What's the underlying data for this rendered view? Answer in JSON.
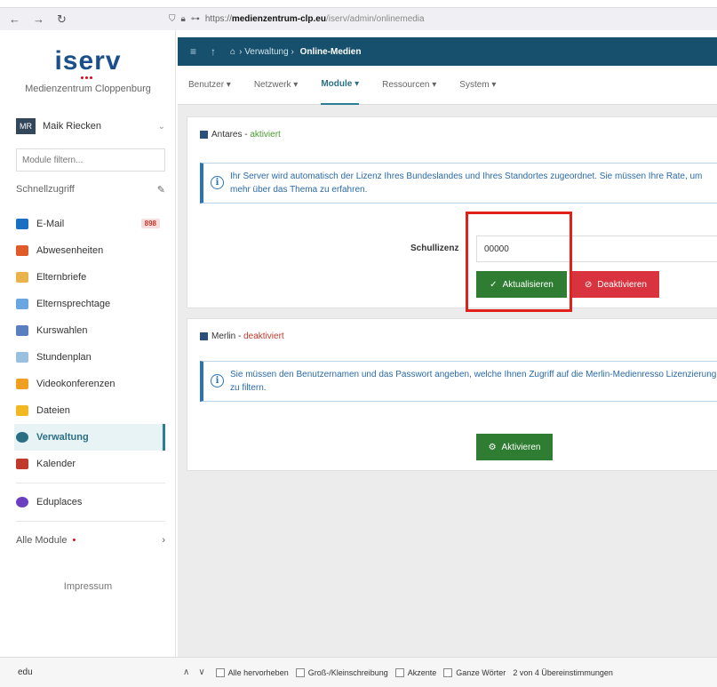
{
  "browser": {
    "back": "←",
    "forward": "→",
    "reload": "↻",
    "url_prefix": "https://",
    "url_domain": "medienzentrum-clp.eu",
    "url_path": "/iserv/admin/onlinemedia"
  },
  "sidebar": {
    "logo": "iserv",
    "school": "Medienzentrum Cloppenburg",
    "user_initials": "MR",
    "user_name": "Maik Riecken",
    "filter_placeholder": "Module filtern...",
    "quick_label": "Schnellzugriff",
    "items": [
      {
        "label": "E-Mail",
        "badge": "898",
        "icon": "mail-icon",
        "color": "#1b6fc2"
      },
      {
        "label": "Abwesenheiten",
        "icon": "absence-icon",
        "color": "#e05a2a"
      },
      {
        "label": "Elternbriefe",
        "icon": "letter-icon",
        "color": "#e8b44a"
      },
      {
        "label": "Elternsprechtage",
        "icon": "people-icon",
        "color": "#6aa6e0"
      },
      {
        "label": "Kurswahlen",
        "icon": "course-icon",
        "color": "#5a7fc0"
      },
      {
        "label": "Stundenplan",
        "icon": "timetable-icon",
        "color": "#9ac0e0"
      },
      {
        "label": "Videokonferenzen",
        "icon": "video-icon",
        "color": "#f0a020"
      },
      {
        "label": "Dateien",
        "icon": "folder-icon",
        "color": "#f2b824"
      },
      {
        "label": "Verwaltung",
        "icon": "gear-icon",
        "color": "#2b6f83",
        "active": true
      },
      {
        "label": "Kalender",
        "icon": "calendar-icon",
        "color": "#c0392b"
      }
    ],
    "extra_item": {
      "label": "Eduplaces",
      "icon": "eduplaces-icon",
      "color": "#6a3fc0"
    },
    "all_modules": "Alle Module",
    "impressum": "Impressum"
  },
  "topbar": {
    "breadcrumb_section": "Verwaltung",
    "breadcrumb_page": "Online-Medien"
  },
  "subnav": {
    "tabs": [
      "Benutzer ▾",
      "Netzwerk ▾",
      "Module ▾",
      "Ressourcen ▾",
      "System ▾"
    ],
    "active_index": 2
  },
  "antares": {
    "name": "Antares",
    "status": "aktiviert",
    "info": "Ihr Server wird automatisch der Lizenz Ihres Bundeslandes und Ihres Standortes zugeordnet. Sie müssen Ihre Rate, um mehr über das Thema zu erfahren.",
    "license_label": "Schullizenz",
    "license_value": "00000",
    "update_label": "Aktualisieren",
    "deactivate_label": "Deaktivieren"
  },
  "merlin": {
    "name": "Merlin",
    "status": "deaktiviert",
    "info": "Sie müssen den Benutzernamen und das Passwort angeben, welche Ihnen Zugriff auf die Merlin-Medienresso Lizenzierung zu filtern.",
    "activate_label": "Aktivieren"
  },
  "findbar": {
    "query": "edu",
    "options": [
      "Alle hervorheben",
      "Groß-/Kleinschreibung",
      "Akzente",
      "Ganze Wörter"
    ],
    "result": "2 von 4 Übereinstimmungen"
  }
}
